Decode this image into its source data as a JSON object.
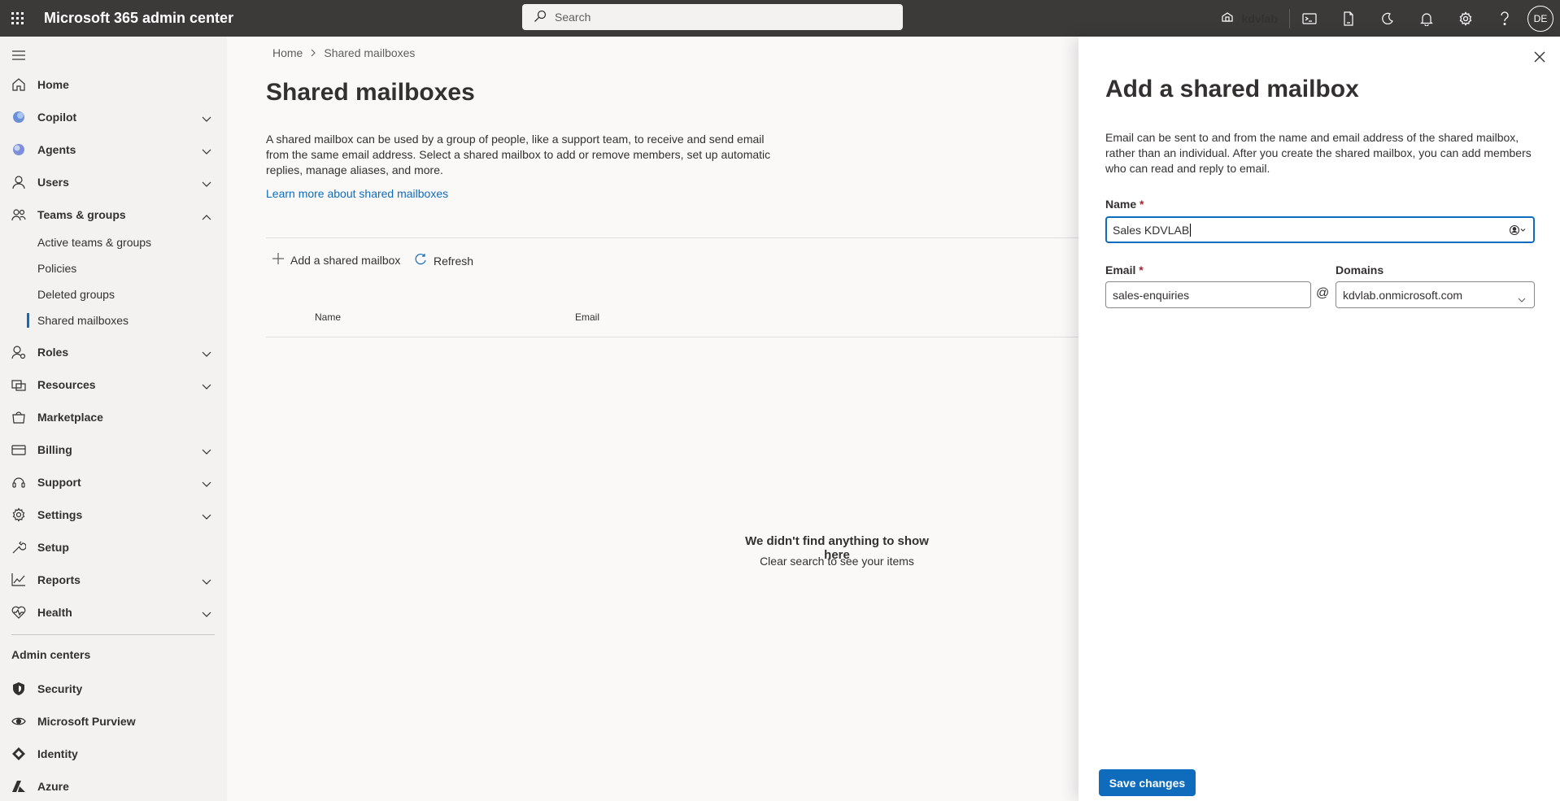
{
  "topbar": {
    "app_title": "Microsoft 365 admin center",
    "search_placeholder": "Search",
    "tenant": "kdvlab",
    "avatar_initials": "DE",
    "icons": [
      "waffle-icon",
      "search-icon",
      "tenant-icon",
      "terminal-icon",
      "mobile-doc-icon",
      "moon-icon",
      "bell-icon",
      "gear-icon",
      "help-icon"
    ]
  },
  "nav": {
    "items": [
      {
        "label": "Home",
        "icon": "home-icon",
        "expandable": false
      },
      {
        "label": "Copilot",
        "icon": "copilot-icon",
        "expandable": true
      },
      {
        "label": "Agents",
        "icon": "agents-icon",
        "expandable": true
      },
      {
        "label": "Users",
        "icon": "user-icon",
        "expandable": true
      },
      {
        "label": "Teams & groups",
        "icon": "teams-groups-icon",
        "expandable": true,
        "expanded": true
      },
      {
        "label": "Roles",
        "icon": "roles-icon",
        "expandable": true
      },
      {
        "label": "Resources",
        "icon": "resources-icon",
        "expandable": true
      },
      {
        "label": "Marketplace",
        "icon": "marketplace-icon",
        "expandable": false
      },
      {
        "label": "Billing",
        "icon": "billing-icon",
        "expandable": true
      },
      {
        "label": "Support",
        "icon": "support-icon",
        "expandable": true
      },
      {
        "label": "Settings",
        "icon": "settings-icon",
        "expandable": true
      },
      {
        "label": "Setup",
        "icon": "setup-icon",
        "expandable": false
      },
      {
        "label": "Reports",
        "icon": "reports-icon",
        "expandable": true
      },
      {
        "label": "Health",
        "icon": "health-icon",
        "expandable": true
      }
    ],
    "sub_items": [
      "Active teams & groups",
      "Policies",
      "Deleted groups",
      "Shared mailboxes"
    ],
    "admin_centers_heading": "Admin centers",
    "admin_centers": [
      {
        "label": "Security",
        "icon": "security-icon"
      },
      {
        "label": "Microsoft Purview",
        "icon": "purview-icon"
      },
      {
        "label": "Identity",
        "icon": "identity-icon"
      },
      {
        "label": "Azure",
        "icon": "azure-icon"
      }
    ]
  },
  "main": {
    "breadcrumb": [
      "Home",
      "Shared mailboxes"
    ],
    "title": "Shared mailboxes",
    "description": "A shared mailbox can be used by a group of people, like a support team, to receive and send email from the same email address. Select a shared mailbox to add or remove members, set up automatic replies, manage aliases, and more.",
    "learn_more": "Learn more about shared mailboxes",
    "commands": {
      "add": "Add a shared mailbox",
      "refresh": "Refresh"
    },
    "columns": [
      "Name",
      "Email"
    ],
    "empty_title": "We didn't find anything to show here",
    "empty_subtitle": "Clear search to see your items"
  },
  "panel": {
    "title": "Add a shared mailbox",
    "description": "Email can be sent to and from the name and email address of the shared mailbox, rather than an individual. After you create the shared mailbox, you can add members who can read and reply to email.",
    "name_label": "Name",
    "name_value": "Sales KDVLAB",
    "email_label": "Email",
    "email_value": "sales-enquiries",
    "at_sign": "@",
    "domains_label": "Domains",
    "domains_value": "kdvlab.onmicrosoft.com",
    "required_mark": "*",
    "save_label": "Save changes"
  },
  "colors": {
    "topbar": "#3b3a39",
    "accent": "#0f6cbd",
    "nav_bg": "#f3f2f1"
  }
}
